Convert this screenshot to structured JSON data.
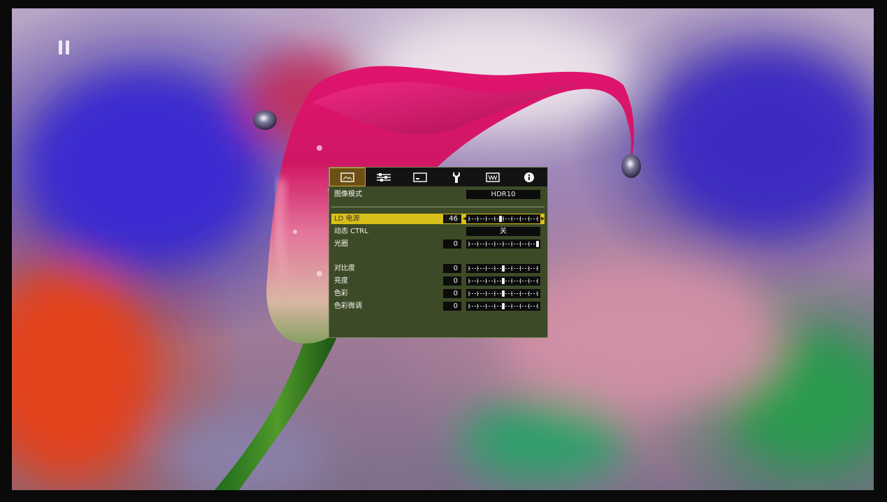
{
  "menu": {
    "tabs": [
      {
        "icon": "picture-icon",
        "active": true
      },
      {
        "icon": "sliders-icon",
        "active": false
      },
      {
        "icon": "display-icon",
        "active": false
      },
      {
        "icon": "wrench-icon",
        "active": false
      },
      {
        "icon": "input-icon",
        "active": false
      },
      {
        "icon": "info-icon",
        "active": false
      }
    ],
    "picture_mode": {
      "label": "图像模式",
      "value": "HDR10"
    },
    "ld_power": {
      "label": "LD 电源",
      "value": "46",
      "slider_min": 0,
      "slider_max": 100,
      "slider_value": 46
    },
    "dynamic_ctrl": {
      "label": "动态 CTRL",
      "value": "关"
    },
    "aperture": {
      "label": "光圈",
      "value": "0",
      "slider_level": 1.0
    },
    "contrast": {
      "label": "对比度",
      "value": "0",
      "slider_level": 0.5
    },
    "brightness": {
      "label": "亮度",
      "value": "0",
      "slider_level": 0.5
    },
    "color": {
      "label": "色彩",
      "value": "0",
      "slider_level": 0.5
    },
    "tint": {
      "label": "色彩微调",
      "value": "0",
      "slider_level": 0.5
    },
    "colors": {
      "highlight": "#d9bf1a",
      "panel": "#3d4a27",
      "active_tab": "#6b4f14"
    }
  },
  "player": {
    "state_icon": "pause-icon"
  }
}
